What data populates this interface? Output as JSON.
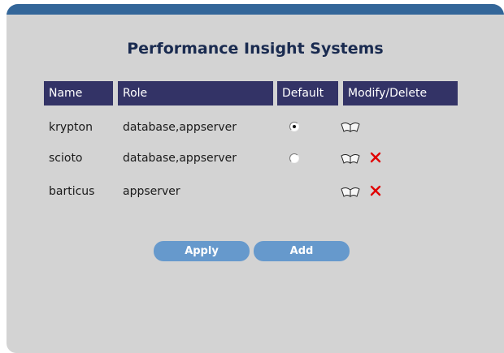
{
  "title": "Performance Insight Systems",
  "columns": {
    "name": "Name",
    "role": "Role",
    "default": "Default",
    "modify_delete": "Modify/Delete"
  },
  "rows": [
    {
      "name": "krypton",
      "role": "database,appserver",
      "default": "selected",
      "modify": true,
      "delete": false
    },
    {
      "name": "scioto",
      "role": "database,appserver",
      "default": "unselected",
      "modify": true,
      "delete": true
    },
    {
      "name": "barticus",
      "role": "appserver",
      "default": "none",
      "modify": true,
      "delete": true
    }
  ],
  "buttons": {
    "apply": "Apply",
    "add": "Add"
  },
  "icons": {
    "modify": "open-book-icon",
    "delete": "red-x-icon"
  },
  "colors": {
    "header_bg": "#333366",
    "panel_bg": "#d3d3d3",
    "top_bar": "#336699",
    "button_bg": "#6699cc",
    "title": "#1a2b50",
    "delete": "#e00000"
  }
}
